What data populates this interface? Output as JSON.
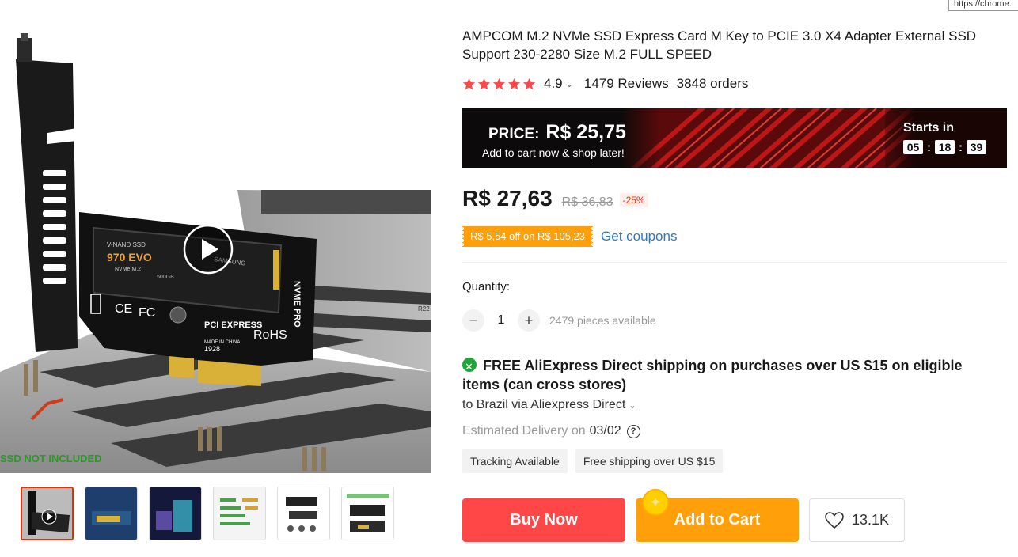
{
  "url_tooltip": "https://chrome.",
  "gallery": {
    "overlay_text": "SSD NOT INCLUDED",
    "board_texts": {
      "brand": "V-NAND SSD",
      "model": "970 EVO",
      "model_sub": "NVMe M.2",
      "capacity": "500GB",
      "samsung": "SAMSUNG",
      "nvme": "NVME PRO",
      "rohs": "RoHS",
      "pci": "PCI EXPRESS",
      "made_in": "MADE IN CHINA",
      "serial": "1928",
      "ce": "CE",
      "fc": "FC",
      "r22": "R22"
    },
    "thumbnails": [
      "thumb-1",
      "thumb-2",
      "thumb-3",
      "thumb-4",
      "thumb-5",
      "thumb-6"
    ]
  },
  "product": {
    "title": "AMPCOM M.2 NVMe SSD Express Card M Key to PCIE 3.0 X4 Adapter External SSD Support 230-2280 Size M.2 FULL SPEED",
    "rating": "4.9",
    "stars": 5,
    "reviews": "1479 Reviews",
    "orders": "3848 orders"
  },
  "promo": {
    "price_label": "PRICE:",
    "price_value": "R$ 25,75",
    "subtitle": "Add to cart now & shop later!",
    "starts_label": "Starts in",
    "timer": {
      "hours": "05",
      "minutes": "18",
      "seconds": "39"
    }
  },
  "price": {
    "current": "R$ 27,63",
    "original": "R$ 36,83",
    "discount": "-25%"
  },
  "coupon": {
    "label": "R$ 5,54 off on R$ 105,23",
    "link": "Get coupons"
  },
  "quantity": {
    "label": "Quantity:",
    "value": "1",
    "minus": "−",
    "plus": "+",
    "available": "2479 pieces available"
  },
  "shipping": {
    "title": "FREE AliExpress Direct shipping on purchases over US $15 on eligible items (can cross stores)",
    "destination": "to Brazil via Aliexpress Direct",
    "eta_label": "Estimated Delivery on",
    "eta_date": "03/02",
    "help": "?",
    "tags": [
      "Tracking Available",
      "Free shipping over US $15"
    ]
  },
  "actions": {
    "buy_now": "Buy Now",
    "add_to_cart": "Add to Cart",
    "wishlist_count": "13.1K"
  },
  "colors": {
    "accent_red": "#ff4747",
    "accent_orange": "#ff9f0a",
    "star": "#ff4747",
    "link": "#2e77c8"
  }
}
